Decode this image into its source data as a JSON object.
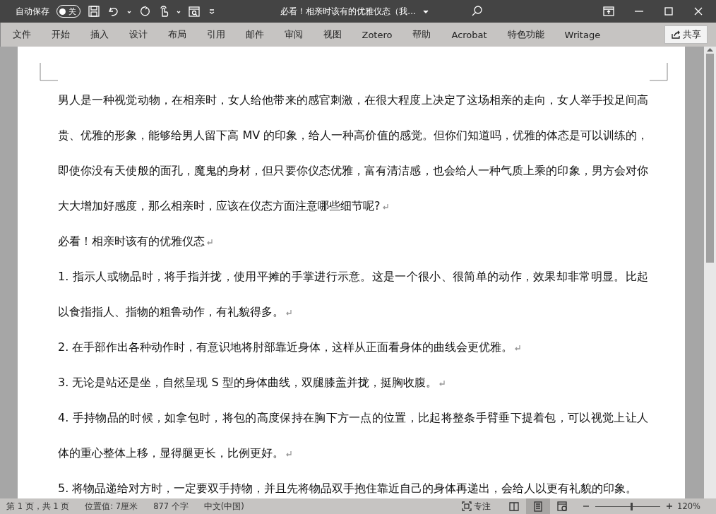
{
  "autosave": {
    "label": "自动保存",
    "on": false,
    "state_text": "关"
  },
  "title": "必看！相亲时该有的优雅仪态（我...",
  "ribbon_tabs": [
    {
      "label": "文件"
    },
    {
      "label": "开始"
    },
    {
      "label": "插入"
    },
    {
      "label": "设计"
    },
    {
      "label": "布局"
    },
    {
      "label": "引用"
    },
    {
      "label": "邮件"
    },
    {
      "label": "审阅"
    },
    {
      "label": "视图"
    },
    {
      "label": "Zotero"
    },
    {
      "label": "帮助"
    },
    {
      "label": "Acrobat"
    },
    {
      "label": "特色功能"
    },
    {
      "label": "Writage"
    }
  ],
  "share_button": "共享",
  "paragraphs": [
    {
      "text": "男人是一种视觉动物，在相亲时，女人给他带来的感官刺激，在很大程度上决定了这场相亲的走向，女人举手投足间高贵、优雅的形象，能够给男人留下高 MV 的印象，给人一种高价值的感觉。但你们知道吗，优雅的体态是可以训练的，即使你没有天使般的面孔，魔鬼的身材，但只要你仪态优雅，富有清洁感，也会给人一种气质上乘的印象，男方会对你大大增加好感度，那么相亲时，应该在仪态方面注意哪些细节呢?",
      "mark": true
    },
    {
      "text": "必看！相亲时该有的优雅仪态",
      "mark": true
    },
    {
      "text": "1. 指示人或物品时，将手指并拢，使用平摊的手掌进行示意。这是一个很小、很简单的动作，效果却非常明显。比起以食指指人、指物的粗鲁动作，有礼貌得多。",
      "mark": true
    },
    {
      "text": "2. 在手部作出各种动作时，有意识地将肘部靠近身体，这样从正面看身体的曲线会更优雅。",
      "mark": true
    },
    {
      "text": "3. 无论是站还是坐，自然呈现 S 型的身体曲线，双腿膝盖并拢，挺胸收腹。",
      "mark": true
    },
    {
      "text": "4. 手持物品的时候，如拿包时，将包的高度保持在胸下方一点的位置，比起将整条手臂垂下提着包，可以视觉上让人体的重心整体上移，显得腿更长，比例更好。",
      "mark": true
    },
    {
      "text": "5. 将物品递给对方时，一定要双手持物，并且先将物品双手抱住靠近自己的身体再递出，会给人以更有礼貌的印象。",
      "mark": false
    }
  ],
  "status": {
    "page": "第 1 页，共 1 页",
    "position": "位置值: 7厘米",
    "words": "877 个字",
    "language": "中文(中国)",
    "focus": "专注",
    "views": [
      {
        "kind": "read",
        "selected": false
      },
      {
        "kind": "print",
        "selected": true
      },
      {
        "kind": "web",
        "selected": false
      }
    ],
    "zoom_slider": {
      "level": 0.55
    },
    "zoom": "120%"
  }
}
